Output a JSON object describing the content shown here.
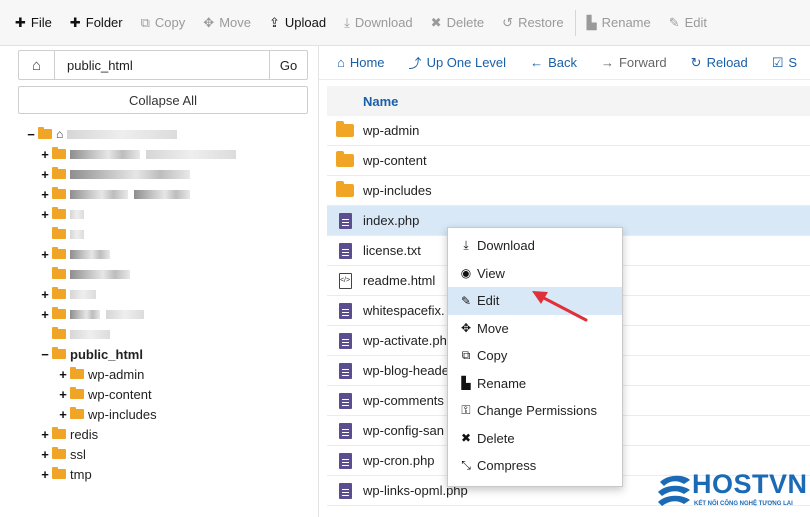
{
  "toolbar": {
    "items": [
      {
        "label": "File",
        "icon": "plus-icon",
        "glyph": "✚",
        "enabled": true
      },
      {
        "label": "Folder",
        "icon": "plus-icon",
        "glyph": "✚",
        "enabled": true
      },
      {
        "label": "Copy",
        "icon": "copy-icon",
        "glyph": "⧉",
        "enabled": false
      },
      {
        "label": "Move",
        "icon": "move-icon",
        "glyph": "✥",
        "enabled": false
      },
      {
        "label": "Upload",
        "icon": "upload-icon",
        "glyph": "⇪",
        "enabled": true
      },
      {
        "label": "Download",
        "icon": "download-icon",
        "glyph": "⤓",
        "enabled": false
      },
      {
        "label": "Delete",
        "icon": "delete-icon",
        "glyph": "✖",
        "enabled": false
      },
      {
        "label": "Restore",
        "icon": "restore-icon",
        "glyph": "↺",
        "enabled": false
      },
      {
        "label": "Rename",
        "icon": "rename-icon",
        "glyph": "▙",
        "enabled": false
      },
      {
        "label": "Edit",
        "icon": "edit-icon",
        "glyph": "✎",
        "enabled": false
      }
    ]
  },
  "path_bar": {
    "path": "public_html",
    "go_label": "Go",
    "home_icon": "home-icon"
  },
  "collapse_label": "Collapse All",
  "tree": {
    "public_html_label": "public_html",
    "children": [
      "wp-admin",
      "wp-content",
      "wp-includes"
    ],
    "others": [
      "redis",
      "ssl",
      "tmp"
    ]
  },
  "nav": {
    "items": [
      {
        "label": "Home",
        "icon": "home-icon",
        "glyph": "⌂",
        "enabled": true
      },
      {
        "label": "Up One Level",
        "icon": "level-up-icon",
        "glyph": "⤴",
        "enabled": true
      },
      {
        "label": "Back",
        "icon": "arrow-left-icon",
        "glyph": "←",
        "enabled": true
      },
      {
        "label": "Forward",
        "icon": "arrow-right-icon",
        "glyph": "→",
        "enabled": false
      },
      {
        "label": "Reload",
        "icon": "reload-icon",
        "glyph": "↻",
        "enabled": true
      },
      {
        "label": "S",
        "icon": "select-all-icon",
        "glyph": "☑",
        "enabled": true
      }
    ]
  },
  "file_list": {
    "header_name": "Name",
    "rows": [
      {
        "name": "wp-admin",
        "type": "folder"
      },
      {
        "name": "wp-content",
        "type": "folder"
      },
      {
        "name": "wp-includes",
        "type": "folder"
      },
      {
        "name": "index.php",
        "type": "file",
        "selected": true
      },
      {
        "name": "license.txt",
        "type": "file"
      },
      {
        "name": "readme.html",
        "type": "code"
      },
      {
        "name": "whitespacefix.",
        "type": "file"
      },
      {
        "name": "wp-activate.ph",
        "type": "file"
      },
      {
        "name": "wp-blog-heade",
        "type": "file"
      },
      {
        "name": "wp-comments",
        "type": "file"
      },
      {
        "name": "wp-config-san",
        "type": "file"
      },
      {
        "name": "wp-cron.php",
        "type": "file"
      },
      {
        "name": "wp-links-opml.php",
        "type": "file"
      }
    ]
  },
  "context_menu": {
    "items": [
      {
        "label": "Download",
        "icon": "download-icon",
        "glyph": "⤓"
      },
      {
        "label": "View",
        "icon": "eye-icon",
        "glyph": "◉"
      },
      {
        "label": "Edit",
        "icon": "pencil-icon",
        "glyph": "✎",
        "highlighted": true
      },
      {
        "label": "Move",
        "icon": "move-icon",
        "glyph": "✥"
      },
      {
        "label": "Copy",
        "icon": "copy-icon",
        "glyph": "⧉"
      },
      {
        "label": "Rename",
        "icon": "file-icon",
        "glyph": "▙"
      },
      {
        "label": "Change Permissions",
        "icon": "key-icon",
        "glyph": "⚿"
      },
      {
        "label": "Delete",
        "icon": "delete-icon",
        "glyph": "✖"
      },
      {
        "label": "Compress",
        "icon": "compress-icon",
        "glyph": "⤡"
      }
    ]
  },
  "watermark": {
    "brand": "HOSTVN",
    "tagline": "KẾT NỐI CÔNG NGHỆ TƯƠNG LAI"
  },
  "colors": {
    "link_blue": "#1a5fa8",
    "folder_orange": "#f0a527",
    "selection_blue": "#d9e8f6",
    "arrow_red": "#e0303a",
    "file_purple": "#5a4e8f"
  }
}
